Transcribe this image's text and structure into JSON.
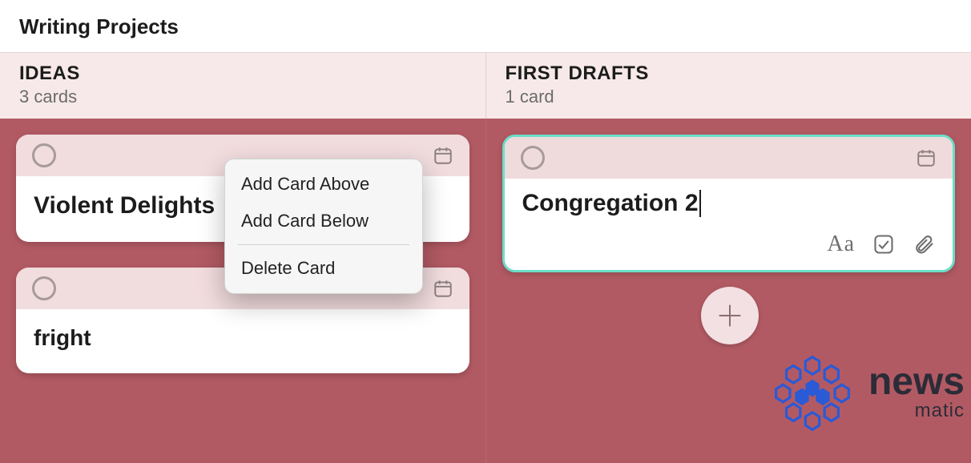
{
  "board": {
    "title": "Writing Projects"
  },
  "columns": [
    {
      "title": "IDEAS",
      "count": "3 cards"
    },
    {
      "title": "FIRST DRAFTS",
      "count": "1 card"
    }
  ],
  "ideas_cards": [
    {
      "title": "Violent Delights"
    },
    {
      "title": "fright"
    }
  ],
  "drafts_card": {
    "title": "Congregation 2"
  },
  "context_menu": {
    "add_above": "Add Card Above",
    "add_below": "Add Card Below",
    "delete": "Delete Card"
  },
  "toolbar": {
    "aa": "Aa"
  },
  "logo": {
    "line1": "news",
    "line2": "matic"
  }
}
